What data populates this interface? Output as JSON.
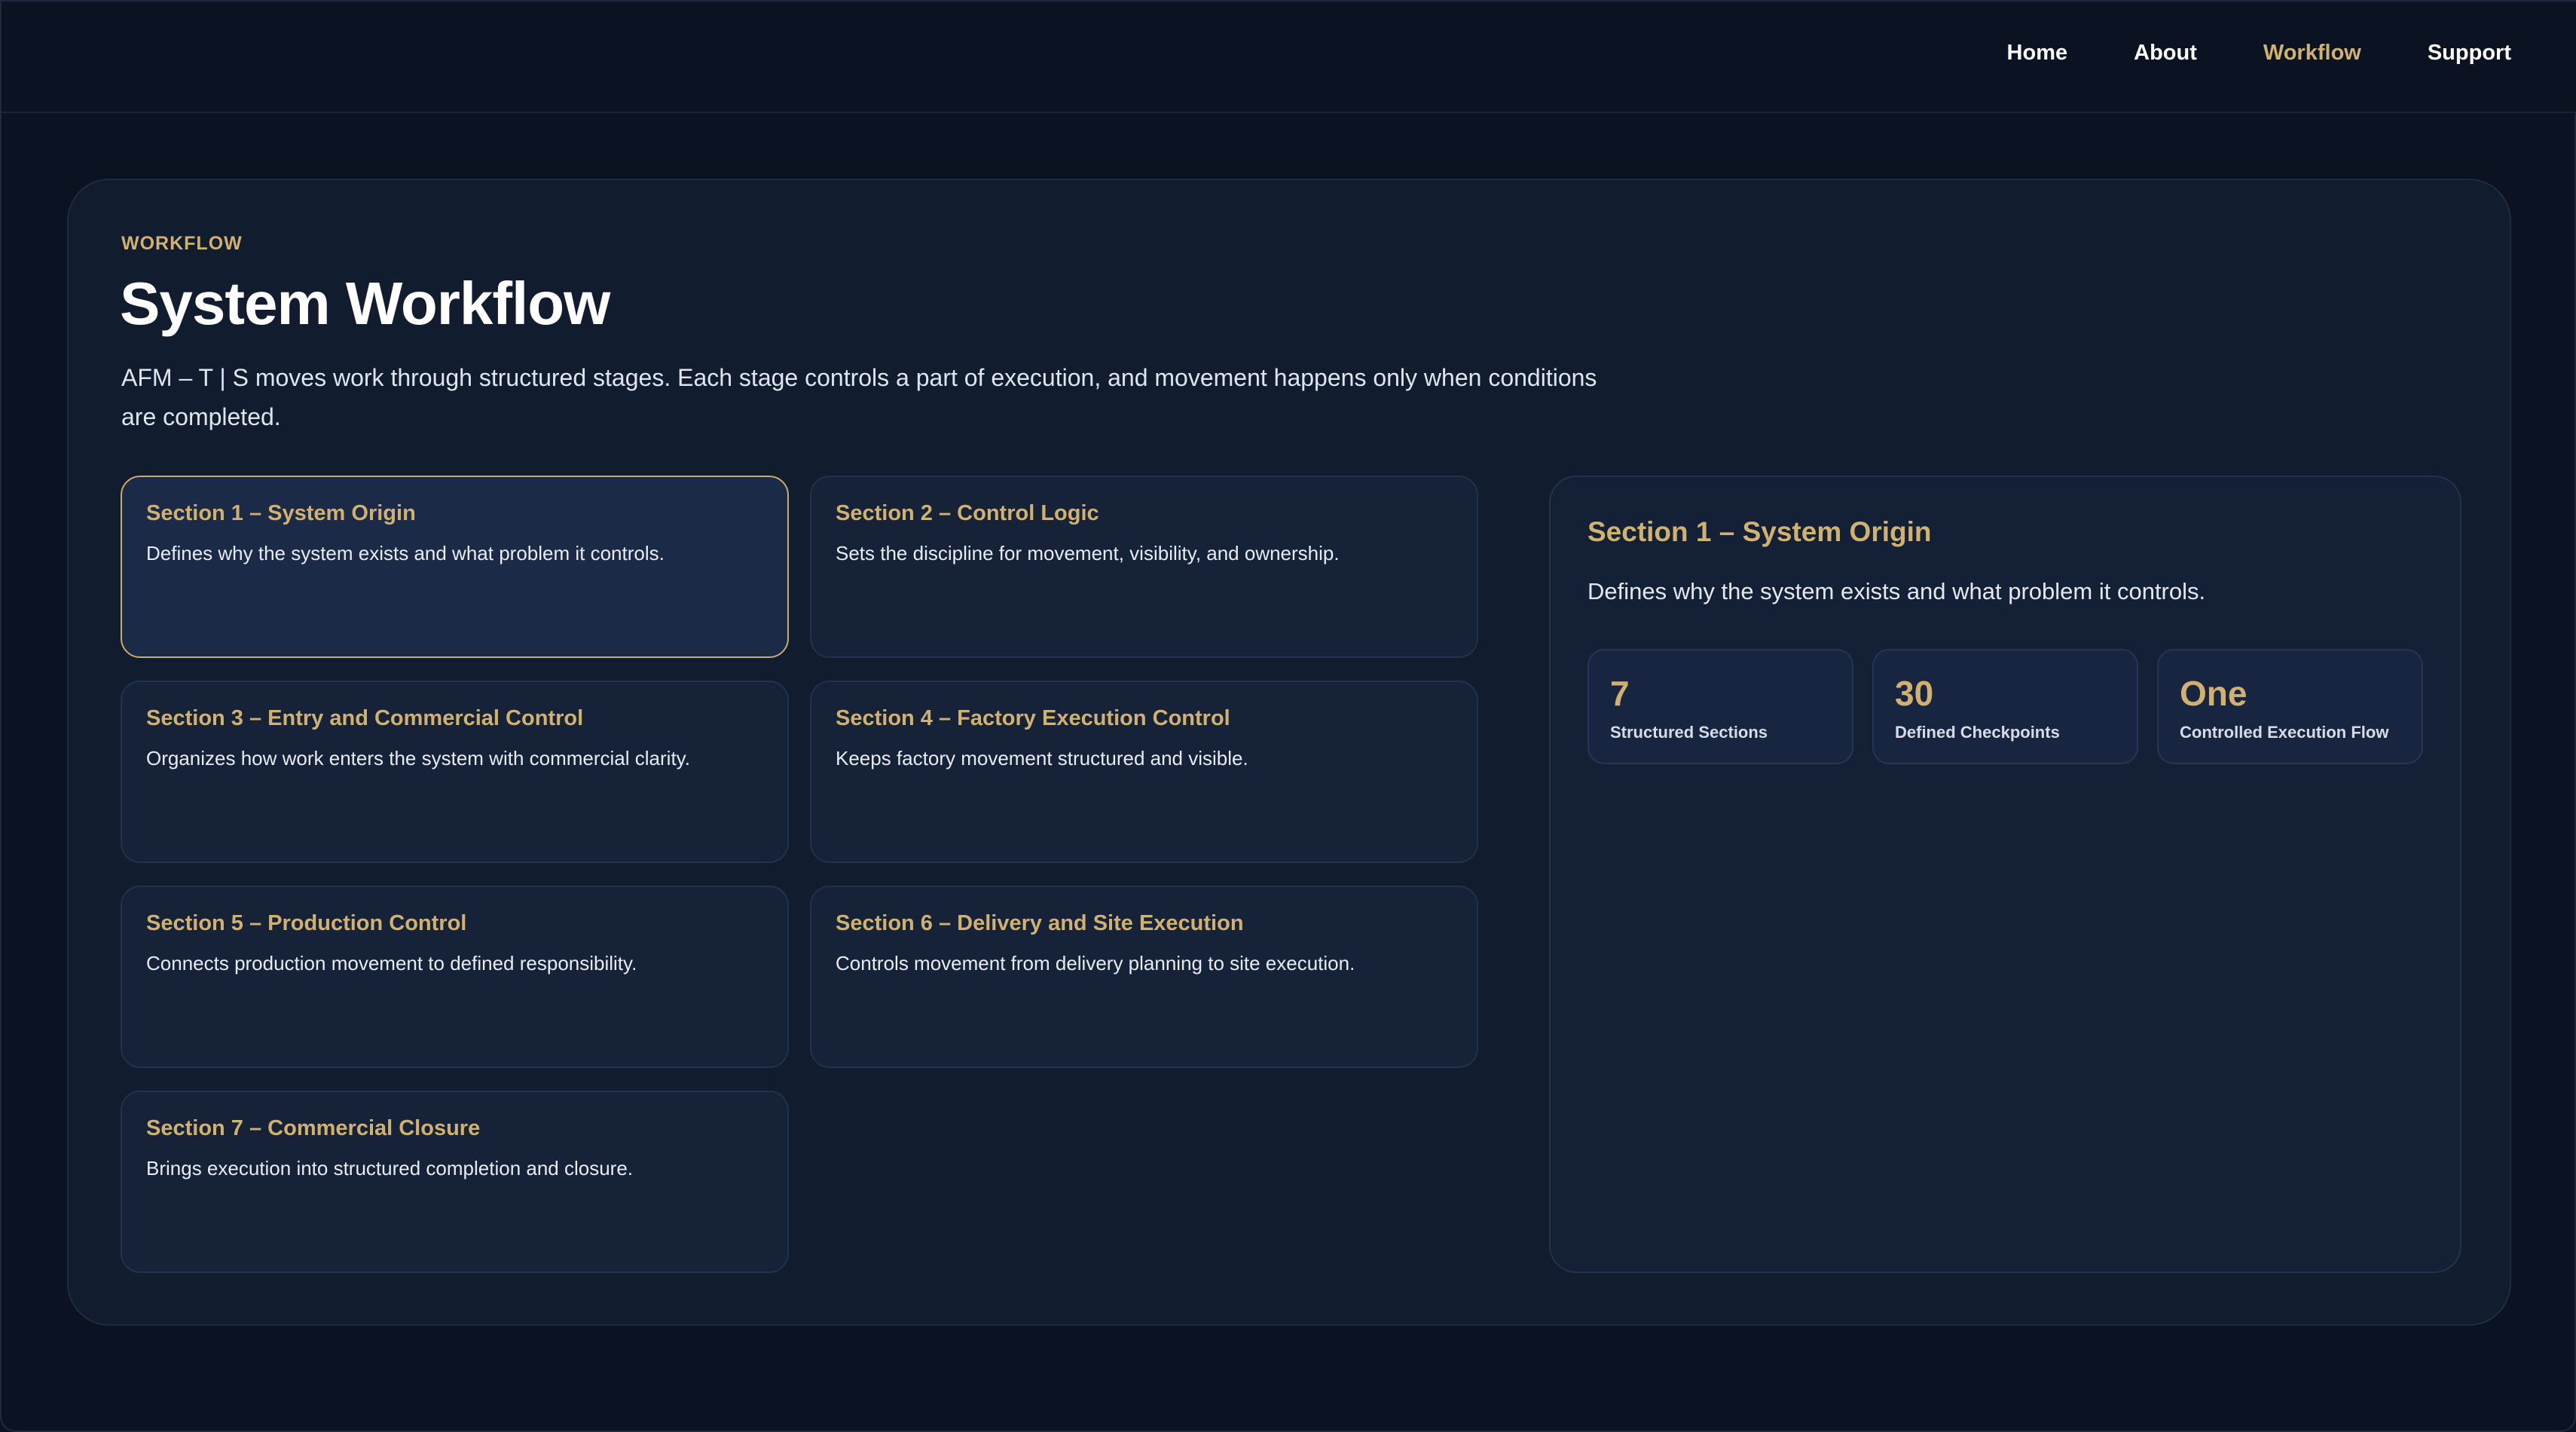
{
  "nav": {
    "items": [
      {
        "label": "Home"
      },
      {
        "label": "About"
      },
      {
        "label": "Workflow"
      },
      {
        "label": "Support"
      }
    ],
    "active": "Workflow"
  },
  "page": {
    "eyebrow": "WORKFLOW",
    "title": "System Workflow",
    "intro": "AFM – T | S moves work through structured stages. Each stage controls a part of execution, and movement happens only when conditions are completed."
  },
  "sections": [
    {
      "title": "Section 1 – System Origin",
      "desc": "Defines why the system exists and what problem it controls."
    },
    {
      "title": "Section 2 – Control Logic",
      "desc": "Sets the discipline for movement, visibility, and ownership."
    },
    {
      "title": "Section 3 – Entry and Commercial Control",
      "desc": "Organizes how work enters the system with commercial clarity."
    },
    {
      "title": "Section 4 – Factory Execution Control",
      "desc": "Keeps factory movement structured and visible."
    },
    {
      "title": "Section 5 – Production Control",
      "desc": "Connects production movement to defined responsibility."
    },
    {
      "title": "Section 6 – Delivery and Site Execution",
      "desc": "Controls movement from delivery planning to site execution."
    },
    {
      "title": "Section 7 – Commercial Closure",
      "desc": "Brings execution into structured completion and closure."
    }
  ],
  "detail": {
    "title": "Section 1 – System Origin",
    "desc": "Defines why the system exists and what problem it controls.",
    "stats": [
      {
        "value": "7",
        "label": "Structured Sections"
      },
      {
        "value": "30",
        "label": "Defined Checkpoints"
      },
      {
        "value": "One",
        "label": "Controlled Execution Flow"
      }
    ]
  },
  "colors": {
    "accent": "#d1b16f",
    "background": "#0b1322",
    "panel": "#111c2e",
    "card": "#162238"
  }
}
